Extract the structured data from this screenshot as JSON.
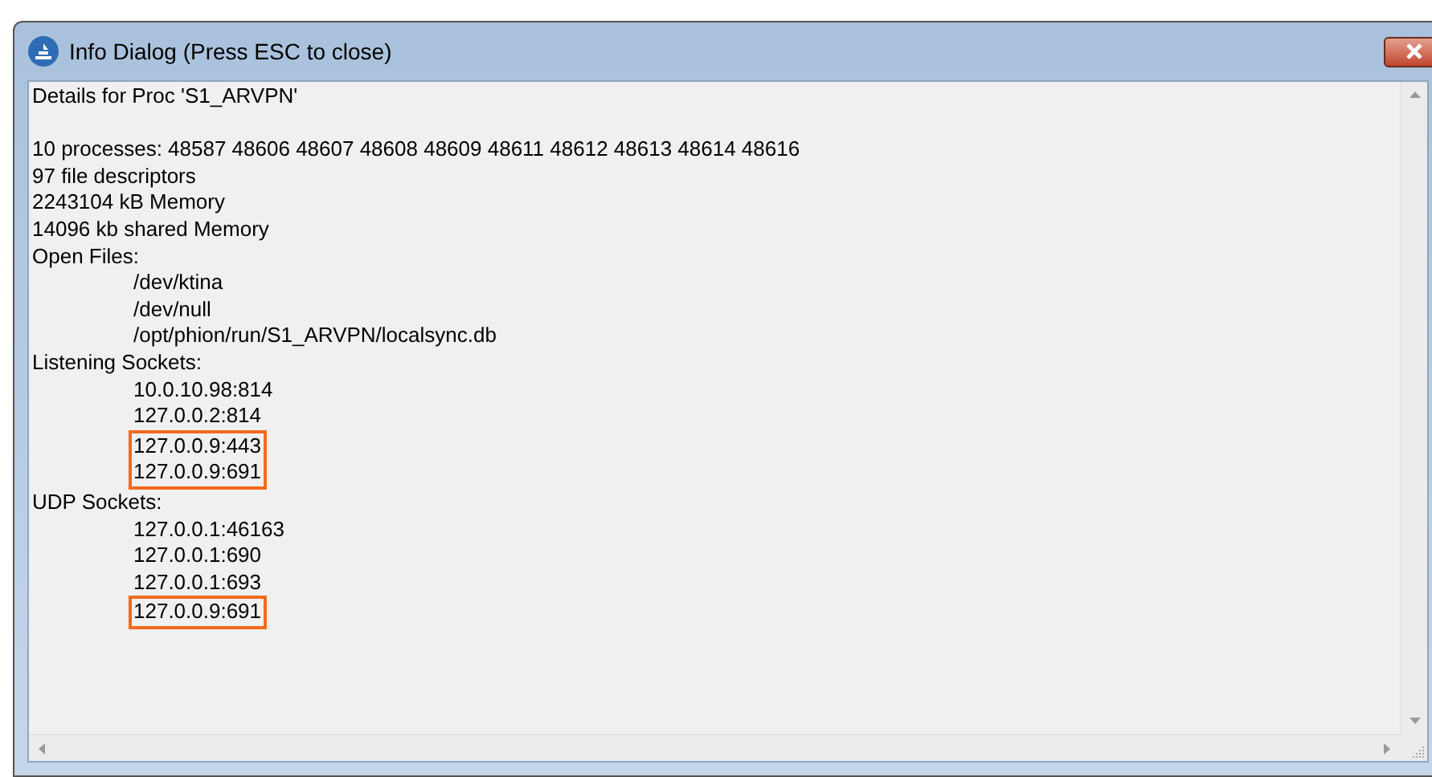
{
  "window": {
    "title": "Info Dialog (Press ESC to close)"
  },
  "heading": "Details for Proc 'S1_ARVPN'",
  "entries": [
    {
      "text": "10 processes: 48587 48606 48607 48608 48609 48611 48612 48613 48614 48616"
    },
    {
      "text": "97 file descriptors"
    },
    {
      "text": "2243104 kB Memory"
    },
    {
      "text": "14096 kb shared Memory"
    },
    {
      "text": "Open Files:",
      "children": [
        {
          "text": "/dev/ktina",
          "highlighted": false
        },
        {
          "text": "/dev/null",
          "highlighted": false
        },
        {
          "text": "/opt/phion/run/S1_ARVPN/localsync.db",
          "highlighted": false
        }
      ]
    },
    {
      "text": "Listening Sockets:",
      "children": [
        {
          "text": "10.0.10.98:814",
          "highlighted": false
        },
        {
          "text": "127.0.0.2:814",
          "highlighted": false
        },
        {
          "text": "127.0.0.9:443",
          "highlighted": true
        },
        {
          "text": "127.0.0.9:691",
          "highlighted": true
        }
      ]
    },
    {
      "text": "UDP Sockets:",
      "children": [
        {
          "text": "127.0.0.1:46163",
          "highlighted": false
        },
        {
          "text": "127.0.0.1:690",
          "highlighted": false
        },
        {
          "text": "127.0.0.1:693",
          "highlighted": false
        },
        {
          "text": "127.0.0.9:691",
          "highlighted": true
        }
      ]
    }
  ]
}
